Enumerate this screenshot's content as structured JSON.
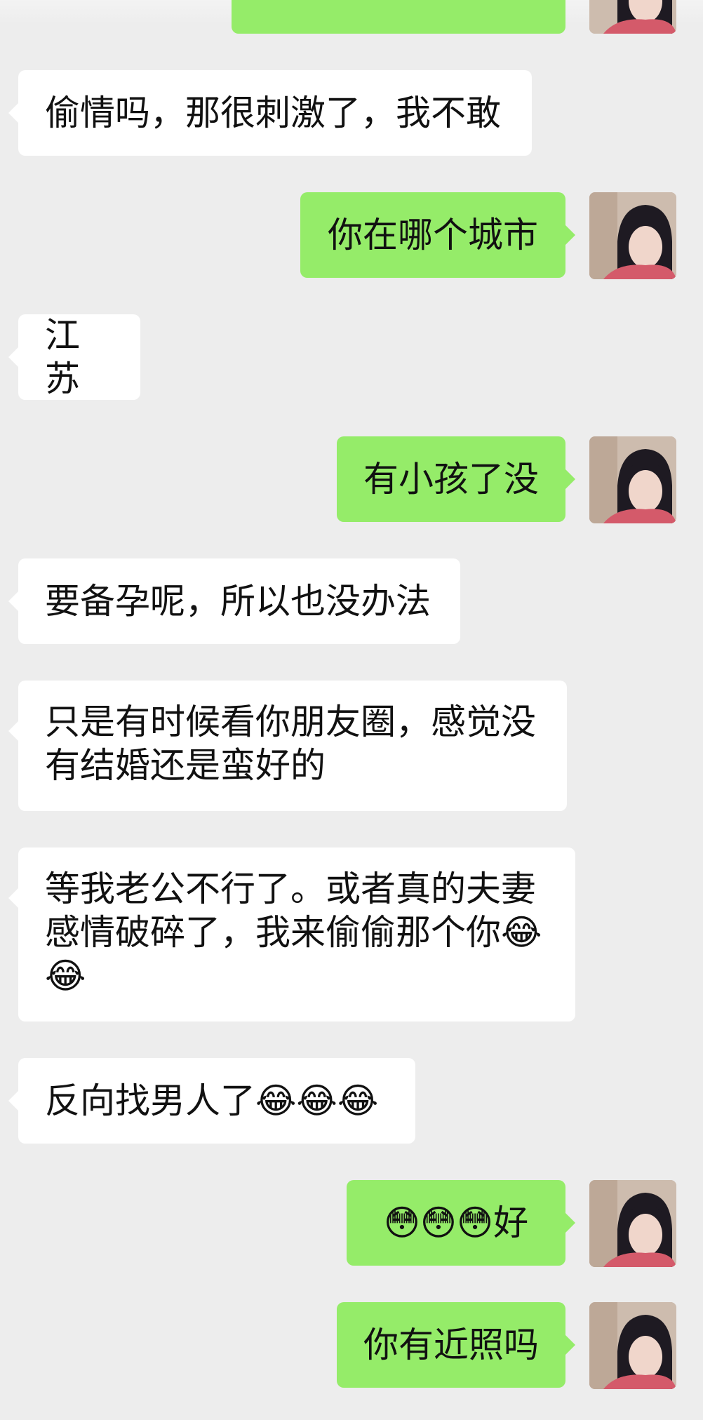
{
  "conversation": {
    "messages": [
      {
        "side": "received",
        "text": "偷情吗，那很刺激了，我不敢"
      },
      {
        "side": "sent",
        "text": "你在哪个城市"
      },
      {
        "side": "received",
        "text": "江苏"
      },
      {
        "side": "sent",
        "text": "有小孩了没"
      },
      {
        "side": "received",
        "text": "要备孕呢，所以也没办法"
      },
      {
        "side": "received",
        "line1": "只是有时候看你朋友圈，感觉没",
        "line2": "有结婚还是蛮好的"
      },
      {
        "side": "received",
        "line1": "等我老公不行了。或者真的夫妻",
        "line2": "感情破碎了，我来偷偷那个你😂",
        "line3": "😂"
      },
      {
        "side": "received",
        "text": "反向找男人了😂😂😂"
      },
      {
        "side": "sent",
        "text": "😳😳😳好"
      },
      {
        "side": "sent",
        "text": "你有近照吗"
      }
    ]
  },
  "colors": {
    "background": "#ededed",
    "sent_bubble": "#95ec69",
    "received_bubble": "#ffffff",
    "text": "#111111"
  },
  "icons": {
    "avatar": "user-avatar-photo",
    "emoji_laugh": "face-with-tears-of-joy",
    "emoji_flushed": "flushed-face"
  }
}
